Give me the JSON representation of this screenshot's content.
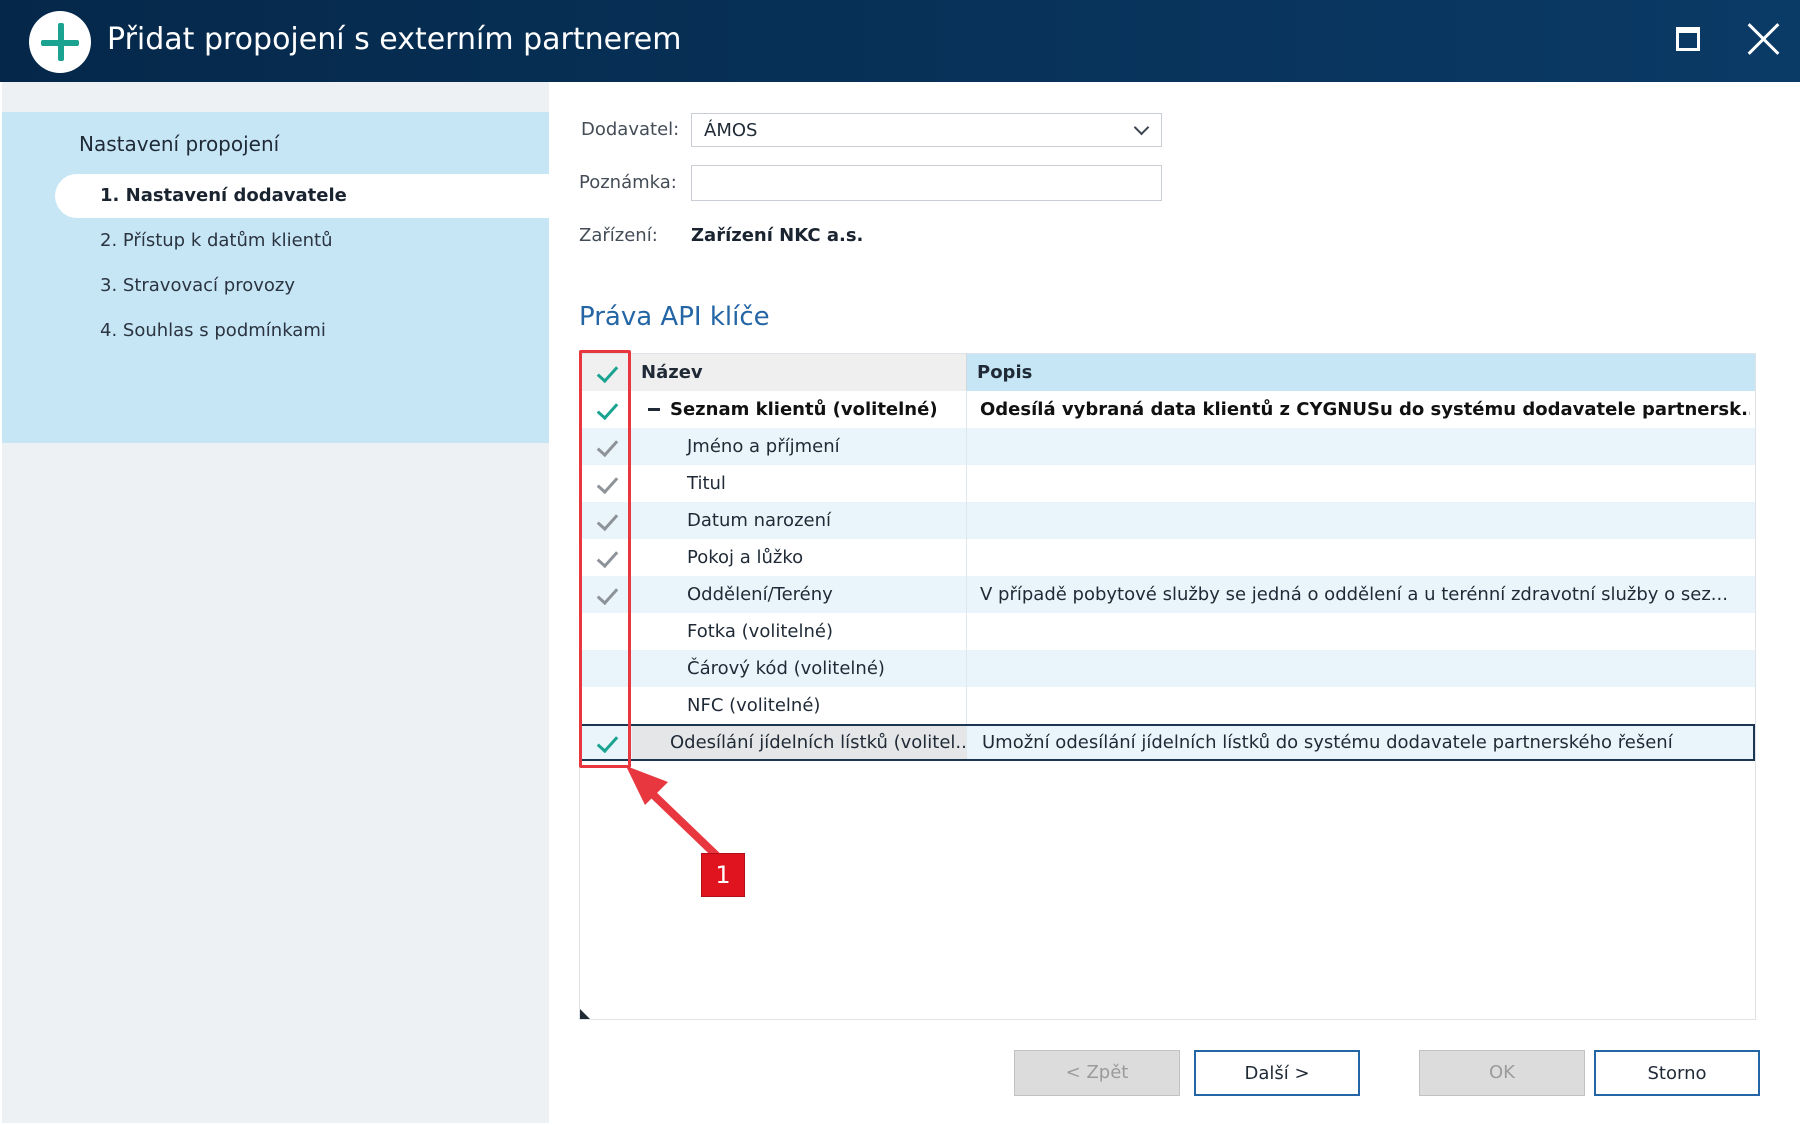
{
  "window": {
    "title": "Přidat propojení s externím partnerem",
    "icons": [
      "add-icon",
      "maximize-icon",
      "close-icon"
    ]
  },
  "sidebar": {
    "heading": "Nastavení propojení",
    "steps": [
      {
        "label": "1. Nastavení dodavatele",
        "active": true
      },
      {
        "label": "2. Přístup k datům klientů",
        "active": false
      },
      {
        "label": "3. Stravovací provozy",
        "active": false
      },
      {
        "label": "4. Souhlas s podmínkami",
        "active": false
      }
    ]
  },
  "form": {
    "supplier_label": "Dodavatel:",
    "supplier_value": "ÁMOS",
    "note_label": "Poznámka:",
    "note_value": "",
    "device_label": "Zařízení:",
    "device_value": "Zařízení NKC a.s."
  },
  "api_rights": {
    "title": "Práva API klíče",
    "columns": {
      "name": "Název",
      "description": "Popis"
    },
    "rows": [
      {
        "name": "Seznam klientů (volitelné)",
        "description": "Odesílá vybraná data klientů z CYGNUSu do systému dodavatele partnersk...",
        "check": "green",
        "bold": true,
        "group": true
      },
      {
        "name": "Jméno a příjmení",
        "description": "",
        "check": "grey"
      },
      {
        "name": "Titul",
        "description": "",
        "check": "grey"
      },
      {
        "name": "Datum narození",
        "description": "",
        "check": "grey"
      },
      {
        "name": "Pokoj a lůžko",
        "description": "",
        "check": "grey"
      },
      {
        "name": "Oddělení/Terény",
        "description": "V případě pobytové služby se jedná o oddělení a u terénní zdravotní služby o sez...",
        "check": "grey"
      },
      {
        "name": "Fotka (volitelné)",
        "description": "",
        "check": "none"
      },
      {
        "name": "Čárový kód (volitelné)",
        "description": "",
        "check": "none"
      },
      {
        "name": "NFC (volitelné)",
        "description": "",
        "check": "none"
      },
      {
        "name": "Odesílání jídelních lístků (volitel...",
        "description": "Umožní odesílání jídelních lístků do systému dodavatele partnerského řešení",
        "check": "green",
        "selected": true
      }
    ]
  },
  "annotation": {
    "badge": "1",
    "color": "#e8373f"
  },
  "buttons": {
    "back": "< Zpět",
    "next": "Další >",
    "ok": "OK",
    "cancel": "Storno"
  },
  "colors": {
    "titlebar": "#05284a",
    "accent": "#2466a5",
    "check_green": "#1aa390",
    "sidebar_panel": "#c6e6f6"
  }
}
